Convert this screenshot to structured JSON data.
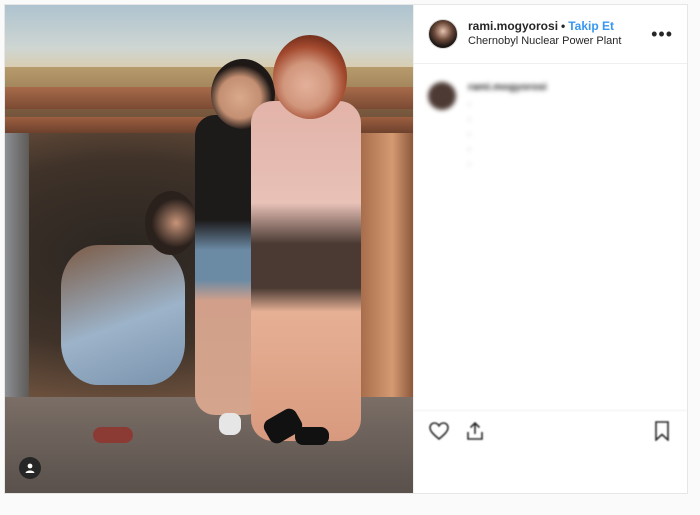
{
  "post": {
    "username": "rami.mogyorosi",
    "separator": "•",
    "follow_label": "Takip Et",
    "location": "Chernobyl Nuclear Power Plant",
    "more_icon": "more-options-icon"
  },
  "caption": {
    "username": "rami.mogyorosi",
    "text": "",
    "bullets": [
      ".",
      ".",
      ".",
      ".",
      "."
    ],
    "hashtags": "",
    "time": ""
  },
  "photo": {
    "user_tag_icon": "user-tag-icon"
  },
  "actions": {
    "like_icon": "heart-icon",
    "share_icon": "share-icon",
    "save_icon": "bookmark-icon"
  },
  "likes_text": "",
  "date_text": "",
  "colors": {
    "follow": "#3897f0",
    "border": "#efefef",
    "text": "#262626"
  }
}
